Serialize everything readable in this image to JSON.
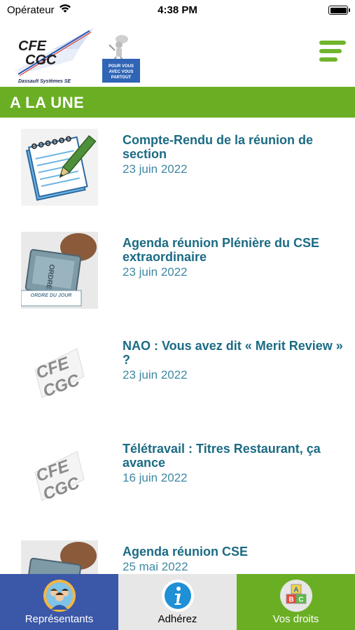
{
  "status": {
    "carrier": "Opérateur",
    "time": "4:38 PM"
  },
  "header": {
    "logo_main": {
      "line1": "CFE",
      "line2": "CGC",
      "caption": "Dassault Systèmes SE"
    },
    "logo_sub": {
      "line1": "POUR VOUS",
      "line2": "AVEC VOUS",
      "line3": "PARTOUT"
    }
  },
  "section": {
    "title": "A LA UNE"
  },
  "articles": [
    {
      "title": "Compte-Rendu de la réunion de section",
      "date": "23 juin 2022",
      "thumb": "notepad-pencil-icon"
    },
    {
      "title": "Agenda réunion Plénière du CSE extraordinaire",
      "date": "23 juin 2022",
      "thumb": "rubber-stamp-icon",
      "stamp_text": "ORDRE DU JOUR"
    },
    {
      "title": "NAO : Vous avez dit « Merit Review » ?",
      "date": "23 juin 2022",
      "thumb": "cfe-cgc-logo"
    },
    {
      "title": "Télétravail : Titres Restaurant, ça avance",
      "date": "16 juin 2022",
      "thumb": "cfe-cgc-logo"
    },
    {
      "title": "Agenda réunion CSE",
      "date": "25 mai 2022",
      "thumb": "rubber-stamp-icon"
    }
  ],
  "tabs": [
    {
      "label": "Représentants",
      "icon": "people-icon",
      "color": "#3b57a8"
    },
    {
      "label": "Adhérez",
      "icon": "info-icon",
      "color": "#e7e7e7"
    },
    {
      "label": "Vos droits",
      "icon": "abc-blocks-icon",
      "color": "#6aaf23"
    }
  ],
  "colors": {
    "accent": "#6aaf23",
    "title": "#1b6b84",
    "date": "#3f88a3"
  }
}
